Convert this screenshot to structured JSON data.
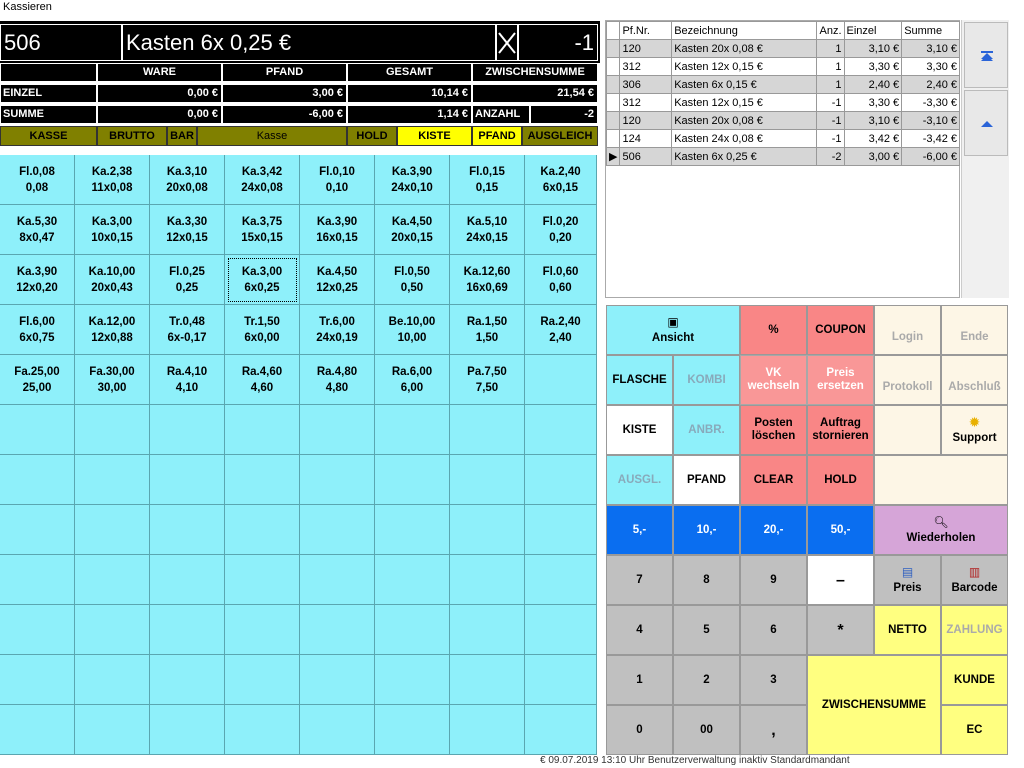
{
  "window": {
    "title": "Kassieren"
  },
  "topbar": {
    "pfand_nr": "506",
    "article": "Kasten 6x 0,25 €",
    "quantity": "-1"
  },
  "totals": {
    "headers": [
      "WARE",
      "PFAND",
      "GESAMT",
      "ZWISCHENSUMME"
    ],
    "einzel_label": "EINZEL",
    "summe_label": "SUMME",
    "einzel": {
      "ware": "0,00 €",
      "pfand": "3,00 €",
      "gesamt": "10,14 €",
      "zwischensumme": "21,54 €"
    },
    "summe": {
      "ware": "0,00 €",
      "pfand": "-6,00 €",
      "gesamt": "1,14 €"
    },
    "anzahl_label": "ANZAHL",
    "anzahl": "-2"
  },
  "modes": [
    "KASSE",
    "BRUTTO",
    "BAR",
    "Kasse",
    "HOLD",
    "KISTE",
    "PFAND",
    "AUSGLEICH"
  ],
  "products": [
    [
      "Fl.0,08",
      "0,08"
    ],
    [
      "Ka.2,38",
      "11x0,08"
    ],
    [
      "Ka.3,10",
      "20x0,08"
    ],
    [
      "Ka.3,42",
      "24x0,08"
    ],
    [
      "Fl.0,10",
      "0,10"
    ],
    [
      "Ka.3,90",
      "24x0,10"
    ],
    [
      "Fl.0,15",
      "0,15"
    ],
    [
      "Ka.2,40",
      "6x0,15"
    ],
    [
      "Ka.5,30",
      "8x0,47"
    ],
    [
      "Ka.3,00",
      "10x0,15"
    ],
    [
      "Ka.3,30",
      "12x0,15"
    ],
    [
      "Ka.3,75",
      "15x0,15"
    ],
    [
      "Ka.3,90",
      "16x0,15"
    ],
    [
      "Ka.4,50",
      "20x0,15"
    ],
    [
      "Ka.5,10",
      "24x0,15"
    ],
    [
      "Fl.0,20",
      "0,20"
    ],
    [
      "Ka.3,90",
      "12x0,20"
    ],
    [
      "Ka.10,00",
      "20x0,43"
    ],
    [
      "Fl.0,25",
      "0,25"
    ],
    [
      "Ka.3,00",
      "6x0,25"
    ],
    [
      "Ka.4,50",
      "12x0,25"
    ],
    [
      "Fl.0,50",
      "0,50"
    ],
    [
      "Ka.12,60",
      "16x0,69"
    ],
    [
      "Fl.0,60",
      "0,60"
    ],
    [
      "Fl.6,00",
      "6x0,75"
    ],
    [
      "Ka.12,00",
      "12x0,88"
    ],
    [
      "Tr.0,48",
      "6x-0,17"
    ],
    [
      "Tr.1,50",
      "6x0,00"
    ],
    [
      "Tr.6,00",
      "24x0,19"
    ],
    [
      "Be.10,00",
      "10,00"
    ],
    [
      "Ra.1,50",
      "1,50"
    ],
    [
      "Ra.2,40",
      "2,40"
    ],
    [
      "Fa.25,00",
      "25,00"
    ],
    [
      "Fa.30,00",
      "30,00"
    ],
    [
      "Ra.4,10",
      "4,10"
    ],
    [
      "Ra.4,60",
      "4,60"
    ],
    [
      "Ra.4,80",
      "4,80"
    ],
    [
      "Ra.6,00",
      "6,00"
    ],
    [
      "Pa.7,50",
      "7,50"
    ],
    [
      "",
      ""
    ]
  ],
  "table": {
    "columns": [
      "Pf.Nr.",
      "Bezeichnung",
      "Anz.",
      "Einzel",
      "Summe"
    ],
    "rows": [
      [
        "120",
        "Kasten 20x 0,08 €",
        "1",
        "3,10 €",
        "3,10 €"
      ],
      [
        "312",
        "Kasten 12x 0,15 €",
        "1",
        "3,30 €",
        "3,30 €"
      ],
      [
        "306",
        "Kasten 6x 0,15 €",
        "1",
        "2,40 €",
        "2,40 €"
      ],
      [
        "312",
        "Kasten 12x 0,15 €",
        "-1",
        "3,30 €",
        "-3,30 €"
      ],
      [
        "120",
        "Kasten 20x 0,08 €",
        "-1",
        "3,10 €",
        "-3,10 €"
      ],
      [
        "124",
        "Kasten 24x 0,08 €",
        "-1",
        "3,42 €",
        "-3,42 €"
      ],
      [
        "506",
        "Kasten 6x 0,25 €",
        "-2",
        "3,00 €",
        "-6,00 €"
      ]
    ]
  },
  "buttons": {
    "ansicht": "Ansicht",
    "percent": "%",
    "coupon": "COUPON",
    "login": "Login",
    "ende": "Ende",
    "flasche": "FLASCHE",
    "kombi": "KOMBI",
    "vk_wechseln": "VK wechseln",
    "preis_ersetzen": "Preis ersetzen",
    "protokoll": "Protokoll",
    "abschluss": "Abschluß",
    "kiste": "KISTE",
    "anbr": "ANBR.",
    "posten_loeschen": "Posten löschen",
    "auftrag_stornieren": "Auftrag stornieren",
    "support": "Support",
    "ausgl": "AUSGL.",
    "pfand": "PFAND",
    "clear": "CLEAR",
    "hold": "HOLD",
    "b5": "5,-",
    "b10": "10,-",
    "b20": "20,-",
    "b50": "50,-",
    "wiederholen": "Wiederholen",
    "n7": "7",
    "n8": "8",
    "n9": "9",
    "minus": "–",
    "preis": "Preis",
    "barcode": "Barcode",
    "n4": "4",
    "n5": "5",
    "n6": "6",
    "star": "*",
    "netto": "NETTO",
    "zahlung": "ZAHLUNG",
    "n1": "1",
    "n2": "2",
    "n3": "3",
    "zwischensumme": "ZWISCHENSUMME",
    "kunde": "KUNDE",
    "n0": "0",
    "n00": "00",
    "comma": ",",
    "ec": "EC"
  },
  "status": {
    "text": "€      09.07.2019    13:10 Uhr   Benutzerverwaltung inaktiv         Standardmandant"
  }
}
